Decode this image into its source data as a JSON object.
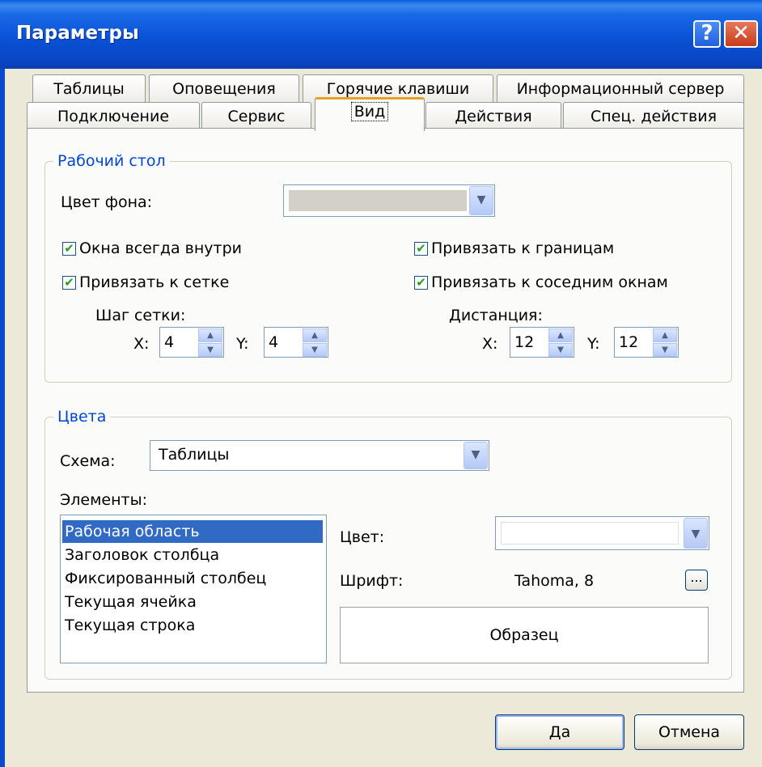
{
  "window": {
    "title": "Параметры",
    "help_glyph": "?",
    "close_glyph": "✕"
  },
  "tabs": {
    "row1": [
      "Таблицы",
      "Оповещения",
      "Горячие клавиши",
      "Информационный сервер"
    ],
    "row2": [
      "Подключение",
      "Сервис",
      "Вид",
      "Действия",
      "Спец. действия"
    ],
    "active": "Вид"
  },
  "desktop": {
    "title": "Рабочий стол",
    "bg_color_label": "Цвет фона:",
    "bg_color_value": "#d4d0c8",
    "windows_inside_label": "Окна всегда внутри",
    "snap_grid_label": "Привязать к сетке",
    "snap_borders_label": "Привязать к границам",
    "snap_windows_label": "Привязать к соседним окнам",
    "grid_step_label": "Шаг сетки:",
    "distance_label": "Дистанция:",
    "x_label": "X:",
    "y_label": "Y:",
    "grid_x": "4",
    "grid_y": "4",
    "dist_x": "12",
    "dist_y": "12",
    "checks": {
      "windows_inside": true,
      "snap_grid": true,
      "snap_borders": true,
      "snap_windows": true
    }
  },
  "colors": {
    "title": "Цвета",
    "scheme_label": "Схема:",
    "scheme_value": "Таблицы",
    "elements_label": "Элементы:",
    "elements": [
      "Рабочая область",
      "Заголовок столбца",
      "Фиксированный столбец",
      "Текущая ячейка",
      "Текущая строка"
    ],
    "selected_element": "Рабочая область",
    "color_label": "Цвет:",
    "font_label": "Шрифт:",
    "font_value": "Tahoma, 8",
    "browse_glyph": "...",
    "sample_label": "Образец"
  },
  "buttons": {
    "ok": "Да",
    "cancel": "Отмена"
  },
  "icons": {
    "checkmark": "✔",
    "dropdown": "▼",
    "spin_up": "▲",
    "spin_down": "▼"
  }
}
